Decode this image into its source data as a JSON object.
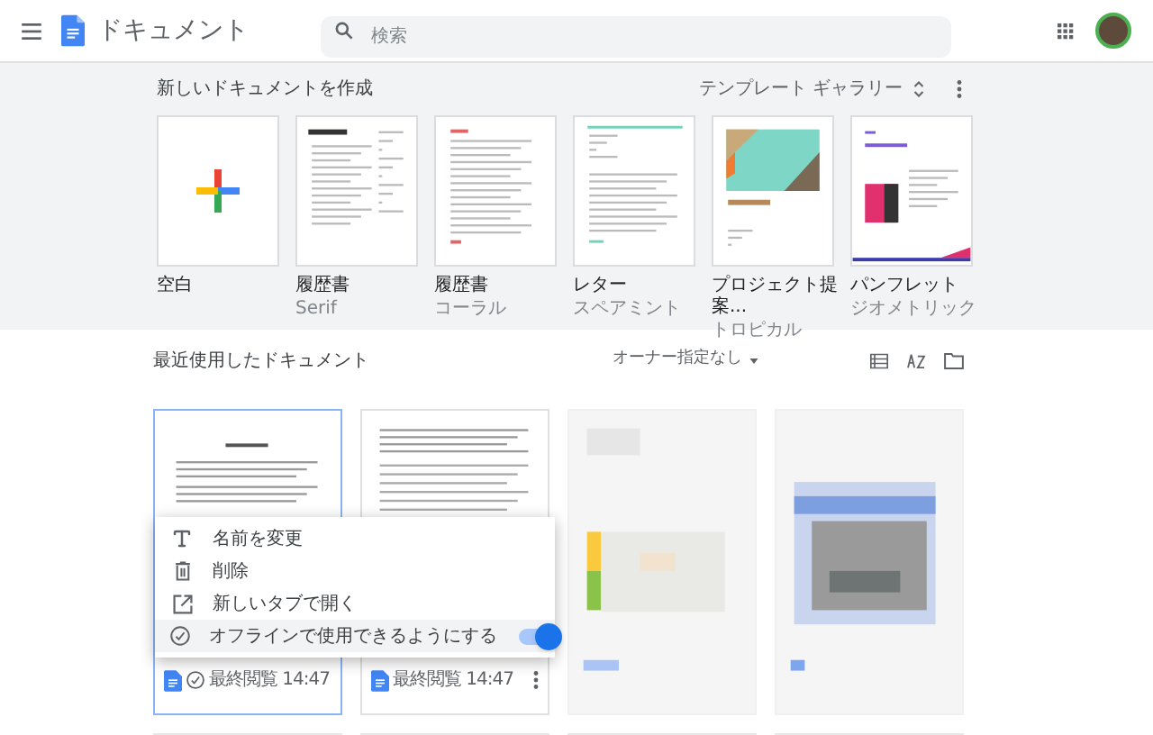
{
  "header": {
    "title": "ドキュメント",
    "search": {
      "placeholder": "検索"
    }
  },
  "templates": {
    "heading": "新しいドキュメントを作成",
    "gallery": "テンプレート ギャラリー",
    "items": [
      {
        "kind": "blank",
        "name": "空白"
      },
      {
        "kind": "resume_serif",
        "name": "履歴書",
        "subtitle": "Serif"
      },
      {
        "kind": "resume_coral",
        "name": "履歴書",
        "subtitle": "コーラル"
      },
      {
        "kind": "letter",
        "name": "レター",
        "subtitle": "スペアミント"
      },
      {
        "kind": "project",
        "name": "プロジェクト提案...",
        "subtitle": "トロピカル"
      },
      {
        "kind": "brochure",
        "name": "パンフレット",
        "subtitle": "ジオメトリック"
      }
    ]
  },
  "recent": {
    "heading": "最近使用したドキュメント",
    "owner_filter": "オーナー指定なし",
    "documents": [
      {
        "kind": "document",
        "footer": "最終閲覧 14:47",
        "offline": true,
        "selected": true
      },
      {
        "kind": "document",
        "footer": "最終閲覧 14:47",
        "offline": false,
        "selected": false
      },
      {
        "kind": "blurred"
      },
      {
        "kind": "blurred"
      }
    ],
    "context_menu": {
      "items": [
        {
          "kind": "rename",
          "label": "名前を変更",
          "selected": false
        },
        {
          "kind": "delete",
          "label": "削除",
          "selected": false
        },
        {
          "kind": "new_tab",
          "label": "新しいタブで開く",
          "selected": false
        },
        {
          "kind": "offline",
          "label": "オフラインで使用できるようにする",
          "on": true,
          "selected": true
        }
      ]
    }
  }
}
